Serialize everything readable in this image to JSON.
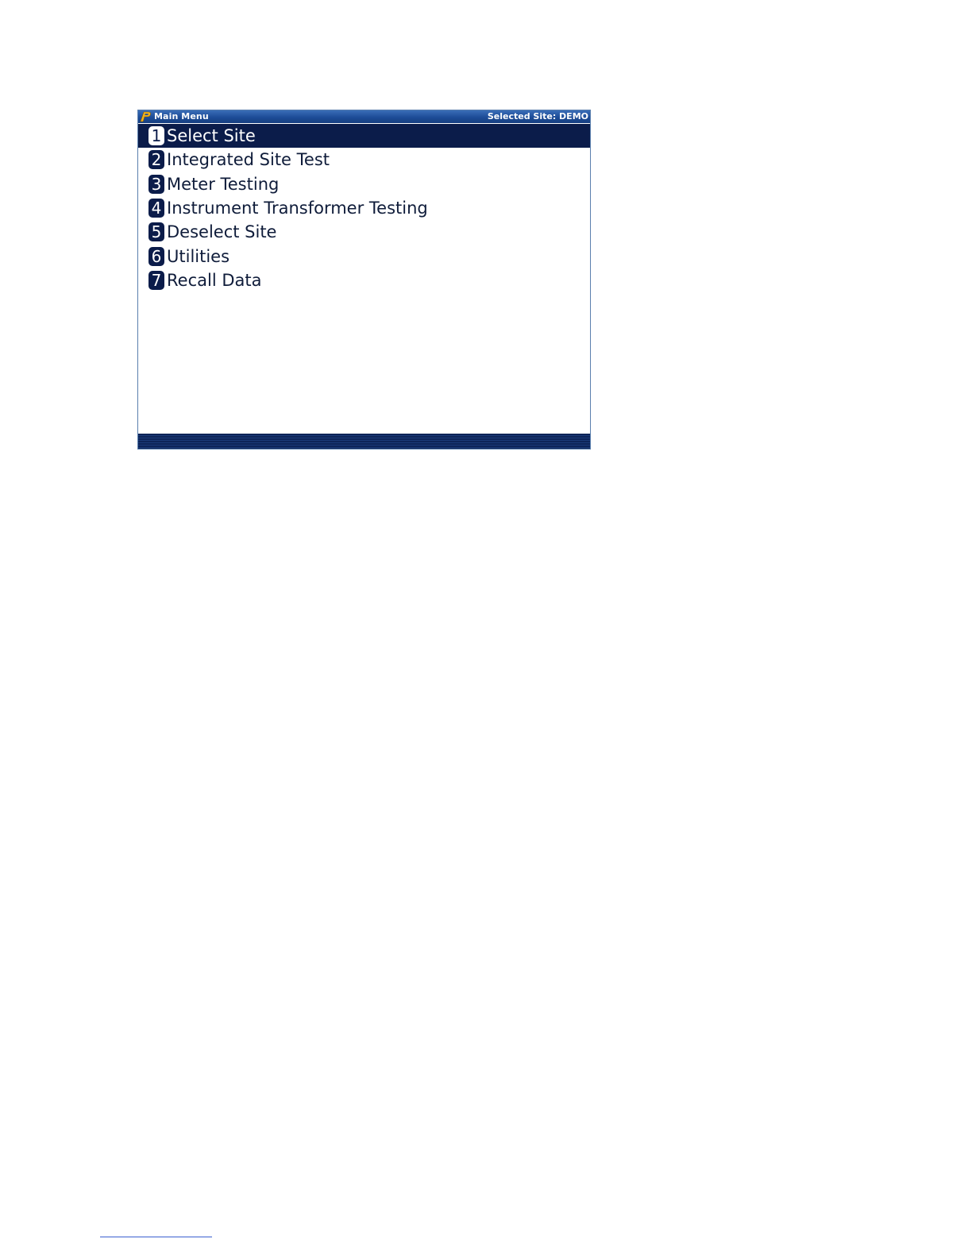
{
  "window": {
    "title": "Main Menu",
    "site_status": "Selected Site: DEMO",
    "logo_icon": "p-logo-icon"
  },
  "menu": {
    "selected_index": 0,
    "items": [
      {
        "number": "1",
        "label": "Select Site"
      },
      {
        "number": "2",
        "label": "Integrated Site Test"
      },
      {
        "number": "3",
        "label": "Meter Testing"
      },
      {
        "number": "4",
        "label": "Instrument Transformer Testing"
      },
      {
        "number": "5",
        "label": "Deselect Site"
      },
      {
        "number": "6",
        "label": "Utilities"
      },
      {
        "number": "7",
        "label": "Recall Data"
      }
    ]
  },
  "colors": {
    "title_bar": "#1d4c97",
    "selection": "#0b1c4a",
    "badge": "#0b1c4a",
    "bottom_bar": "#0d2458"
  }
}
